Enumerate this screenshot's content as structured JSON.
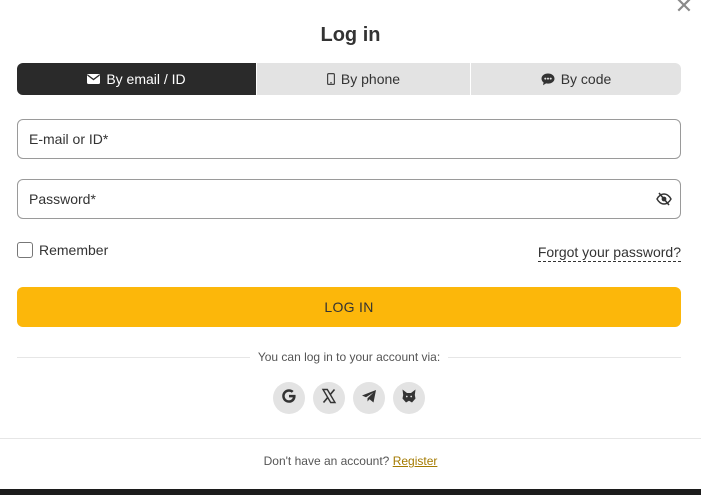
{
  "dialog": {
    "title": "Log in",
    "close_icon": "close-icon"
  },
  "tabs": [
    {
      "label": "By email / ID",
      "icon": "envelope-icon",
      "active": true
    },
    {
      "label": "By phone",
      "icon": "phone-icon",
      "active": false
    },
    {
      "label": "By code",
      "icon": "chat-bubble-icon",
      "active": false
    }
  ],
  "form": {
    "email_placeholder": "E-mail or ID*",
    "email_value": "",
    "password_placeholder": "Password*",
    "password_value": "",
    "password_toggle_icon": "eye-slash-icon",
    "remember_label": "Remember",
    "remember_checked": false,
    "forgot_label": "Forgot your password?",
    "submit_label": "LOG IN"
  },
  "social": {
    "via_text": "You can log in to your account via:",
    "providers": [
      "google-icon",
      "x-icon",
      "telegram-icon",
      "metamask-icon"
    ]
  },
  "footer": {
    "prompt": "Don't have an account?",
    "register_label": "Register"
  },
  "colors": {
    "accent": "#fcb70a",
    "active_tab": "#2a2a2a",
    "inactive_tab": "#e3e3e3",
    "link": "#a47a00"
  }
}
